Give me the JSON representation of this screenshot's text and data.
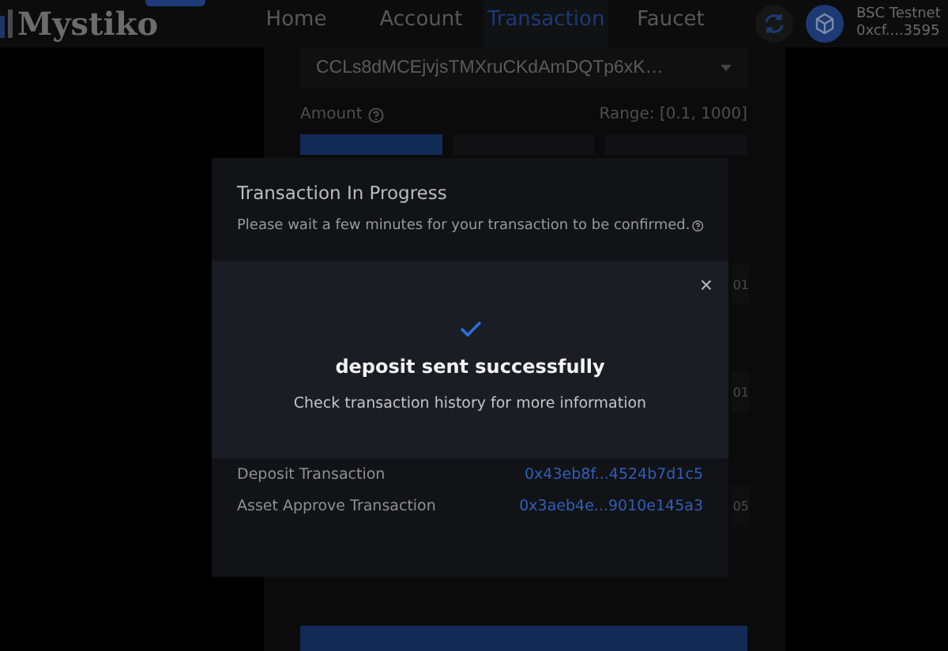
{
  "navbar": {
    "logo": "Mystiko",
    "tabs": [
      {
        "label": "Home",
        "selected": false
      },
      {
        "label": "Account",
        "selected": false
      },
      {
        "label": "Transaction",
        "selected": true
      },
      {
        "label": "Faucet",
        "selected": false
      }
    ],
    "network": "BSC Testnet",
    "address": "0xcf....3595"
  },
  "form": {
    "token_select": "CCLs8dMCEjvjsTMXruCKdAmDQTp6xK…",
    "amount_label": "Amount",
    "range": "Range: [0.1, 1000]",
    "amount_options": [
      {
        "selected": true
      },
      {
        "selected": false
      },
      {
        "selected": false
      }
    ],
    "field_values": [
      "01",
      "01",
      "05"
    ]
  },
  "progress_dialog": {
    "title": "Transaction In Progress",
    "message": "Please wait a few minutes for your transaction to be confirmed.",
    "rows": [
      {
        "label": "Deposit Transaction",
        "value": "0x43eb8f...4524b7d1c5"
      },
      {
        "label": "Asset Approve Transaction",
        "value": "0x3aeb4e...9010e145a3"
      }
    ]
  },
  "success_toast": {
    "close": "×",
    "title": "deposit sent successfully",
    "message": "Check transaction history for more information"
  }
}
